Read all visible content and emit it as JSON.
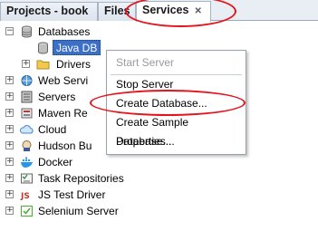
{
  "tabs": {
    "projects": "Projects - book",
    "files": "Files",
    "services": "Services"
  },
  "tree": {
    "databases": "Databases",
    "java_db": "Java DB",
    "drivers": "Drivers",
    "web_services": "Web Servi",
    "servers": "Servers",
    "maven": "Maven Re",
    "cloud": "Cloud",
    "hudson": "Hudson Bu",
    "docker": "Docker",
    "task_repositories": "Task Repositories",
    "js_test_driver": "JS Test Driver",
    "selenium_server": "Selenium Server"
  },
  "context_menu": {
    "start_server": "Start Server",
    "stop_server": "Stop Server",
    "create_database": "Create Database...",
    "create_sample_database": "Create Sample Database...",
    "properties": "Properties..."
  },
  "colors": {
    "annotation_red": "#e4131c",
    "selection_blue": "#3c6fc6",
    "disabled_gray": "#9a9a9a"
  }
}
